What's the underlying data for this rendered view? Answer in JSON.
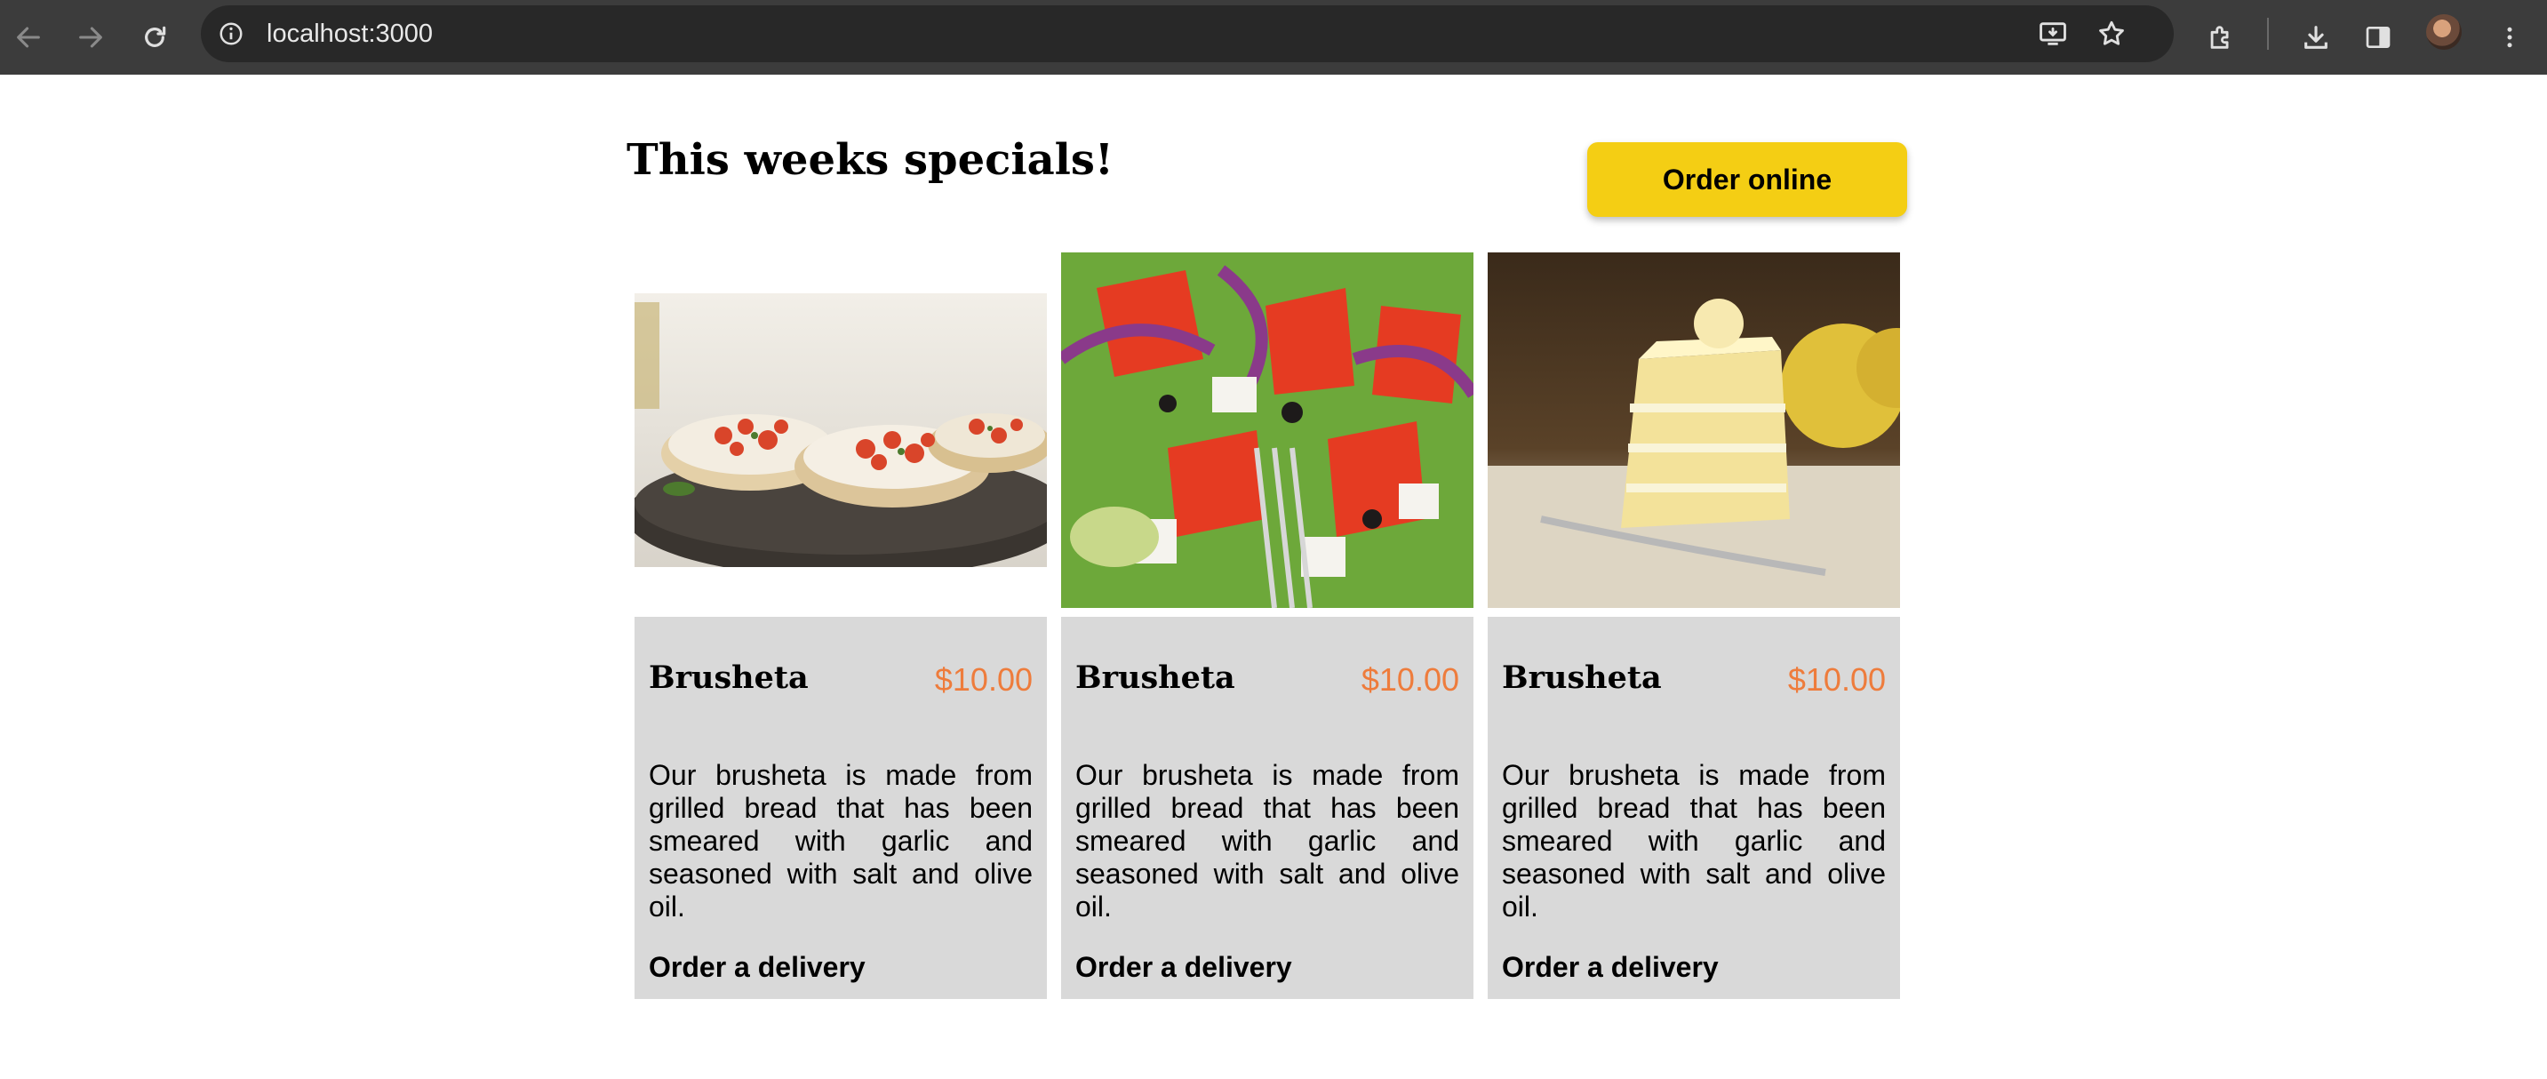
{
  "browser": {
    "url": "localhost:3000"
  },
  "page": {
    "title": "This weeks specials!",
    "order_button": "Order online"
  },
  "specials": [
    {
      "name": "Brusheta",
      "price": "$10.00",
      "description": "Our brusheta is made from grilled bread that has been smeared with garlic and seasoned with salt and olive oil.",
      "link": "Order a delivery",
      "image": "bruschetta-photo"
    },
    {
      "name": "Brusheta",
      "price": "$10.00",
      "description": "Our brusheta is made from grilled bread that has been smeared with garlic and seasoned with salt and olive oil.",
      "link": "Order a delivery",
      "image": "greek-salad-photo"
    },
    {
      "name": "Brusheta",
      "price": "$10.00",
      "description": "Our brusheta is made from grilled bread that has been smeared with garlic and seasoned with salt and olive oil.",
      "link": "Order a delivery",
      "image": "lemon-cake-photo"
    }
  ],
  "colors": {
    "accent_yellow": "#F4CE14",
    "price_orange": "#EE7C3C",
    "card_background": "#D9D9D9",
    "chrome_dark": "#3C3C3C"
  }
}
